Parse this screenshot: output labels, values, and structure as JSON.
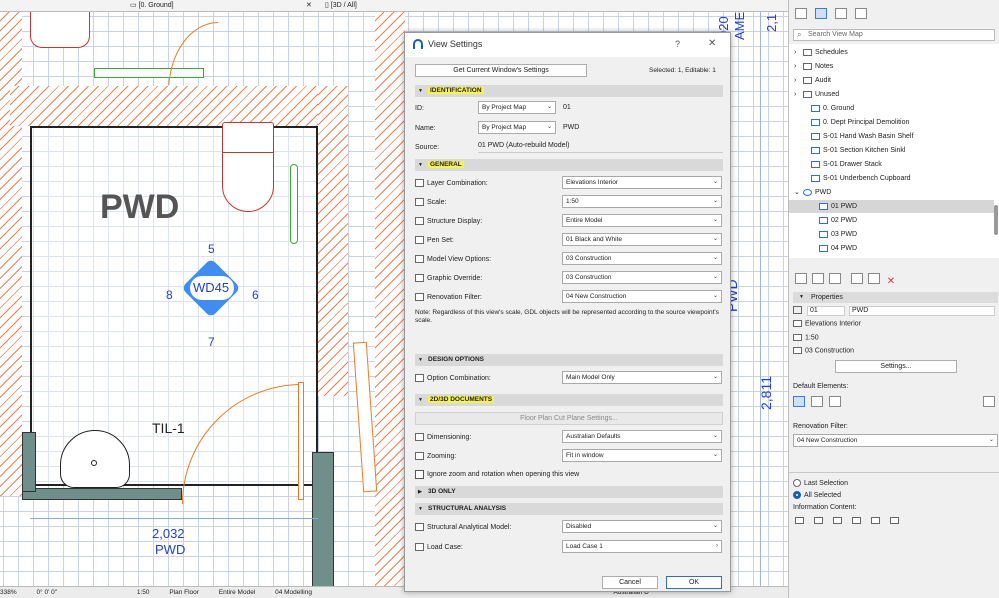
{
  "tabs": {
    "ground": "[0. Ground]",
    "threed": "[3D / All]"
  },
  "plan": {
    "room_name": "PWD",
    "marker_label": "WD45",
    "marker_top": "5",
    "marker_bottom": "7",
    "marker_left": "8",
    "marker_right": "6",
    "label_til": "TIL-1",
    "dim_value": "2,032",
    "dim_name": "PWD",
    "elev_right_a": "PWD",
    "elev_right_b": "2,811",
    "elev_top_a": "920",
    "elev_top_b": "AME",
    "elev_top_c": "2,1"
  },
  "dialog": {
    "title": "View Settings",
    "help": "?",
    "close": "✕",
    "get_settings_button": "Get Current Window's Settings",
    "selected": "Selected: 1, Editable: 1",
    "sections": {
      "identification": "IDENTIFICATION",
      "general": "GENERAL",
      "design_options": "DESIGN OPTIONS",
      "docs": "2D/3D DOCUMENTS",
      "only3d": "3D ONLY",
      "structural": "STRUCTURAL ANALYSIS"
    },
    "id_label": "ID:",
    "id_mode": "By Project Map",
    "id_value": "01",
    "name_label": "Name:",
    "name_mode": "By Project Map",
    "name_value": "PWD",
    "source_label": "Source:",
    "source_value": "01 PWD (Auto-rebuild Model)",
    "general_rows": [
      {
        "label": "Layer Combination:",
        "value": "Elevations Interior"
      },
      {
        "label": "Scale:",
        "value": "1:50"
      },
      {
        "label": "Structure Display:",
        "value": "Entire Model"
      },
      {
        "label": "Pen Set:",
        "value": "01 Black and White"
      },
      {
        "label": "Model View Options:",
        "value": "03 Construction"
      },
      {
        "label": "Graphic Override:",
        "value": "03 Construction"
      },
      {
        "label": "Renovation Filter:",
        "value": "04 New Construction"
      }
    ],
    "note": "Note: Regardless of this view's scale, GDL objects will be represented according to the source viewpoint's scale.",
    "option_combination_label": "Option Combination:",
    "option_combination_value": "Main Model Only",
    "cut_plane_button": "Floor Plan Cut Plane Settings...",
    "dimensioning_label": "Dimensioning:",
    "dimensioning_value": "Australian Defaults",
    "zooming_label": "Zooming:",
    "zooming_value": "Fit in window",
    "ignore_zoom_label": "Ignore zoom and rotation when opening this view",
    "structural_model_label": "Structural Analytical Model:",
    "structural_model_value": "Disabled",
    "load_case_label": "Load Case:",
    "load_case_value": "Load Case 1",
    "cancel": "Cancel",
    "ok": "OK"
  },
  "rightpanel": {
    "search_placeholder": "Search View Map",
    "tree": [
      {
        "label": "Schedules",
        "type": "folder",
        "indent": 1,
        "arrow": "›"
      },
      {
        "label": "Notes",
        "type": "folder",
        "indent": 1,
        "arrow": "›"
      },
      {
        "label": "Audit",
        "type": "folder",
        "indent": 1,
        "arrow": "›"
      },
      {
        "label": "Unused",
        "type": "folder",
        "indent": 1,
        "arrow": "›"
      },
      {
        "label": "0. Ground",
        "type": "view",
        "indent": 2,
        "arrow": ""
      },
      {
        "label": "0. Dept Principal Demolition",
        "type": "view",
        "indent": 2,
        "arrow": ""
      },
      {
        "label": "S-01 Hand Wash Basin Shelf",
        "type": "view",
        "indent": 2,
        "arrow": ""
      },
      {
        "label": "S-01 Section Kitchen Sinkl",
        "type": "view",
        "indent": 2,
        "arrow": ""
      },
      {
        "label": "S-01 Drawer Stack",
        "type": "view",
        "indent": 2,
        "arrow": ""
      },
      {
        "label": "S-01 Underbench Cupboard",
        "type": "view",
        "indent": 2,
        "arrow": ""
      },
      {
        "label": "PWD",
        "type": "group",
        "indent": 1,
        "arrow": "⌄"
      },
      {
        "label": "01 PWD",
        "type": "view",
        "indent": 3,
        "arrow": "",
        "selected": true
      },
      {
        "label": "02 PWD",
        "type": "view",
        "indent": 3,
        "arrow": ""
      },
      {
        "label": "03 PWD",
        "type": "view",
        "indent": 3,
        "arrow": ""
      },
      {
        "label": "04 PWD",
        "type": "view",
        "indent": 3,
        "arrow": ""
      }
    ],
    "properties_title": "Properties",
    "prop_id": "01",
    "prop_name": "PWD",
    "prop_layer": "Elevations Interior",
    "prop_scale": "1:50",
    "prop_mvo": "03 Construction",
    "settings_button": "Settings...",
    "default_elements": "Default Elements:",
    "renovation_filter": "Renovation Filter:",
    "renovation_value": "04 New Construction",
    "last_selection": "Last Selection",
    "all_selected": "All Selected",
    "information_content": "Information Content:"
  },
  "status": {
    "zoom": "338%",
    "angle": "0° 0' 0\"",
    "scale": "1:50",
    "plan_floor": "Plan Floor",
    "entire_model": "Entire Model",
    "modelling": "04 Modelling",
    "australian": "Australian D"
  }
}
